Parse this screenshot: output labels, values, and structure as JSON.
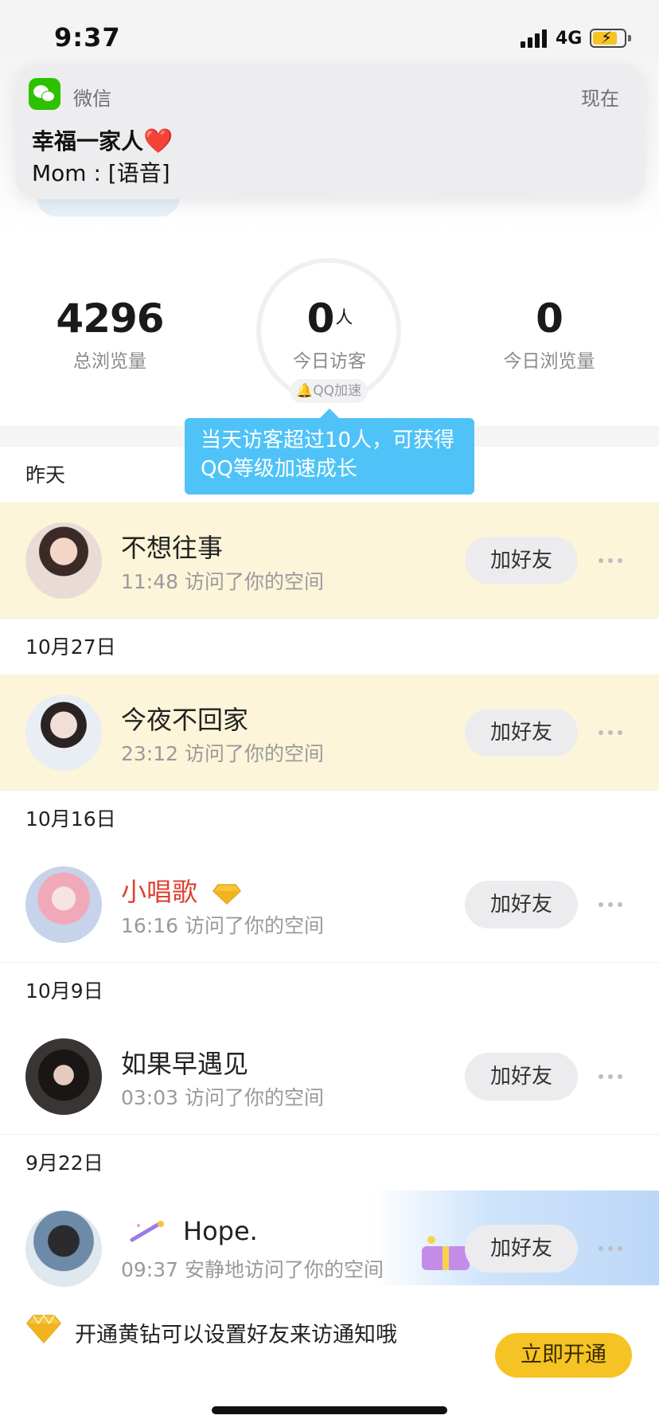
{
  "status_bar": {
    "time": "9:37",
    "network": "4G"
  },
  "notification": {
    "app_name": "微信",
    "time": "现在",
    "title": "幸福一家人",
    "title_emoji": "❤️",
    "body": "Mom : [语音]"
  },
  "stats": {
    "total_views": {
      "value": "4296",
      "label": "总浏览量"
    },
    "today_visitors": {
      "value": "0",
      "unit": "人",
      "label": "今日访客"
    },
    "today_views": {
      "value": "0",
      "label": "今日浏览量"
    },
    "qq_badge": "QQ加速"
  },
  "tooltip": {
    "text": "当天访客超过10人，可获得QQ等级加速成长"
  },
  "visitors": [
    {
      "date": "昨天",
      "name": "不想往事",
      "time": "11:48 访问了你的空间",
      "button": "加好友",
      "highlight": true
    },
    {
      "date": "10月27日",
      "name": "今夜不回家",
      "time": "23:12 访问了你的空间",
      "button": "加好友",
      "highlight": true
    },
    {
      "date": "10月16日",
      "name": "小唱歌",
      "time": "16:16 访问了你的空间",
      "button": "加好友",
      "highlight": false,
      "vip": true
    },
    {
      "date": "10月9日",
      "name": "如果早遇见",
      "time": "03:03 访问了你的空间",
      "button": "加好友",
      "highlight": false
    },
    {
      "date": "9月22日",
      "name": "Hope.",
      "time": "09:37 安静地访问了你的空间",
      "button": "加好友",
      "highlight": false
    }
  ],
  "promo": {
    "text": "开通黄钻可以设置好友来访通知哦",
    "button": "立即开通"
  },
  "colors": {
    "accent_yellow": "#f6c324",
    "tooltip_blue": "#4fc3f7",
    "highlight_row": "#fdf5d9",
    "vip_name_red": "#e04032"
  }
}
